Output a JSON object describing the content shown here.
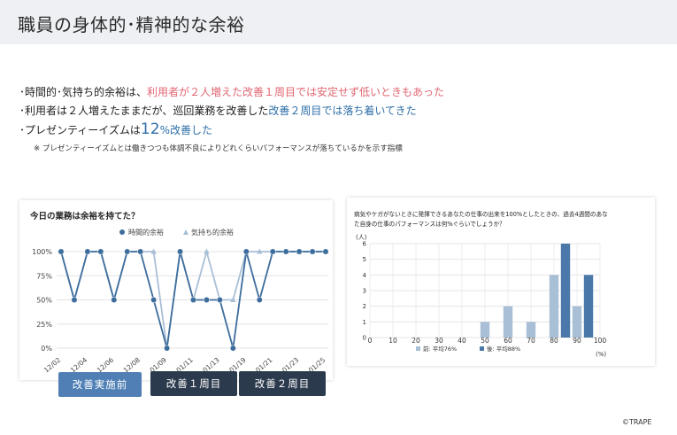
{
  "header": {
    "title": "職員の身体的･精神的な余裕"
  },
  "bullets": {
    "line1_prefix": "･時間的･気持ち的余裕は、",
    "line1_highlight": "利用者が２人増えた改善１周目では安定せず低いときもあった",
    "line2_prefix": "･利用者は２人増えたままだが、巡回業務を改善した",
    "line2_highlight": "改善２周目では落ち着いてきた",
    "line3_prefix": "･プレゼンティーイズムは",
    "line3_number": "12",
    "line3_suffix": "%改善した",
    "note": "※ プレゼンティーイズムとは働きつつも体調不良によりどれくらいパフォーマンスが落ちているかを示す指標"
  },
  "buttons": {
    "before": "改善実施前",
    "week1": "改善１周目",
    "week2": "改善２周目"
  },
  "copyright": "©TRAPE",
  "colors": {
    "dark_blue": "#3d6d9c",
    "light_blue": "#a9bfd6",
    "red_text": "#e06672",
    "button_dark": "#2c3a4d",
    "button_blue": "#4f7fb5"
  },
  "chart_data": [
    {
      "type": "line",
      "title": "今日の業務は余裕を持てた？",
      "legend_position": "top",
      "x": [
        "12/02",
        "12/03",
        "12/04",
        "12/05",
        "12/06",
        "12/07",
        "12/08",
        "12/09",
        "01/09",
        "01/10",
        "01/11",
        "01/12",
        "01/13",
        "01/14",
        "01/19",
        "01/20",
        "01/21",
        "01/22",
        "01/23",
        "01/24",
        "01/25"
      ],
      "x_tick_labels": [
        "12/02",
        "12/04",
        "12/06",
        "12/08",
        "01/09",
        "01/11",
        "01/13",
        "01/19",
        "01/21",
        "01/23",
        "01/25"
      ],
      "y_ticks": [
        "0%",
        "25%",
        "50%",
        "75%",
        "100%"
      ],
      "ylim": [
        0,
        100
      ],
      "grid": true,
      "series": [
        {
          "name": "時間的余裕",
          "color": "#3d6d9c",
          "marker": "circle",
          "values": [
            100,
            50,
            100,
            100,
            50,
            100,
            100,
            50,
            0,
            100,
            50,
            50,
            50,
            0,
            100,
            50,
            100,
            100,
            100,
            100,
            100
          ]
        },
        {
          "name": "気持ち的余裕",
          "color": "#a9bfd6",
          "marker": "triangle",
          "values": [
            100,
            50,
            100,
            100,
            50,
            100,
            100,
            100,
            0,
            100,
            50,
            100,
            50,
            50,
            100,
            100,
            100,
            100,
            100,
            100,
            100
          ]
        }
      ]
    },
    {
      "type": "bar",
      "title_line1": "病気やケガがないときに発揮できるあなたの仕事の出来を100%としたときの、過去4週間のあな",
      "title_line2": "た自身の仕事のパフォーマンスは何%ぐらいでしょうか？",
      "ylabel": "(人)",
      "xlabel": "(%)",
      "x_ticks": [
        0,
        10,
        20,
        30,
        40,
        50,
        60,
        70,
        80,
        90,
        100
      ],
      "ylim": [
        0,
        6
      ],
      "y_ticks": [
        0,
        1,
        2,
        3,
        4,
        5,
        6
      ],
      "grid": true,
      "series": [
        {
          "name": "前: 平均76%",
          "color": "#a9bfd6",
          "x": [
            50,
            60,
            70,
            80,
            90
          ],
          "values": [
            1,
            2,
            1,
            4,
            2
          ]
        },
        {
          "name": "後: 平均88%",
          "color": "#4a78a8",
          "x": [
            85,
            95
          ],
          "values": [
            6,
            4
          ]
        }
      ]
    }
  ]
}
